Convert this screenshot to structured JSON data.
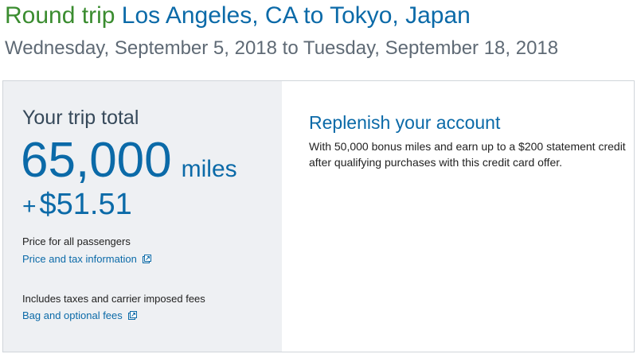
{
  "header": {
    "trip_type": "Round trip",
    "route": "Los Angeles, CA to Tokyo, Japan",
    "dates": "Wednesday, September 5, 2018 to Tuesday, September 18, 2018"
  },
  "total": {
    "label": "Your trip total",
    "miles": "65,000",
    "miles_unit": "miles",
    "plus": "+",
    "cash": "$51.51",
    "passengers_note": "Price for all passengers",
    "price_tax_link": "Price and tax information",
    "fees_note": "Includes taxes and carrier imposed fees",
    "bag_fees_link": "Bag and optional fees"
  },
  "promo": {
    "title": "Replenish your account",
    "text": "With 50,000 bonus miles and earn up to a $200 statement credit after qualifying purchases with this credit card offer."
  },
  "icons": {
    "external_link": "external-link-icon"
  },
  "colors": {
    "trip_type_green": "#3a8c2f",
    "link_blue": "#0b6aa8",
    "panel_gray": "#eef0f3"
  }
}
